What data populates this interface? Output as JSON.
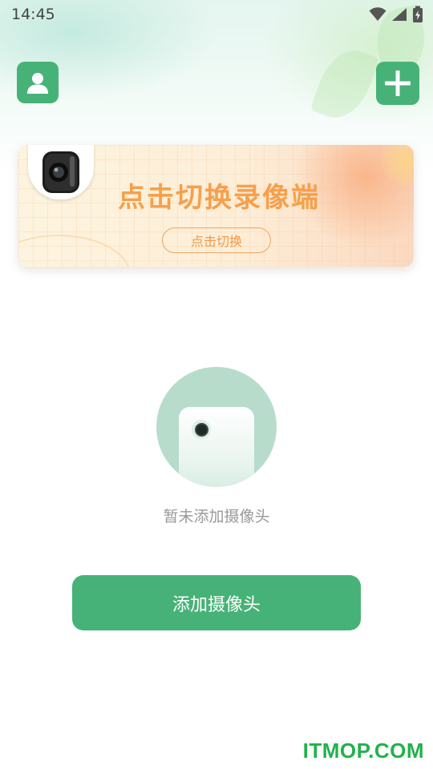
{
  "status_bar": {
    "time": "14:45",
    "icons": [
      "wifi-icon",
      "signal-icon",
      "battery-charging-icon"
    ]
  },
  "header": {
    "profile_icon": "person-icon",
    "add_icon": "plus-icon"
  },
  "banner": {
    "title": "点击切换录像端",
    "button_label": "点击切换",
    "image_icon": "camera-icon"
  },
  "empty_state": {
    "illustration_icon": "camera-device-icon",
    "message": "暂未添加摄像头"
  },
  "primary_action": {
    "label": "添加摄像头"
  },
  "watermark": {
    "text": "ITMOP.COM"
  },
  "colors": {
    "accent_green": "#47b277",
    "banner_orange": "#f6a04b",
    "watermark_green": "#21b24b",
    "muted_text": "#999999"
  }
}
